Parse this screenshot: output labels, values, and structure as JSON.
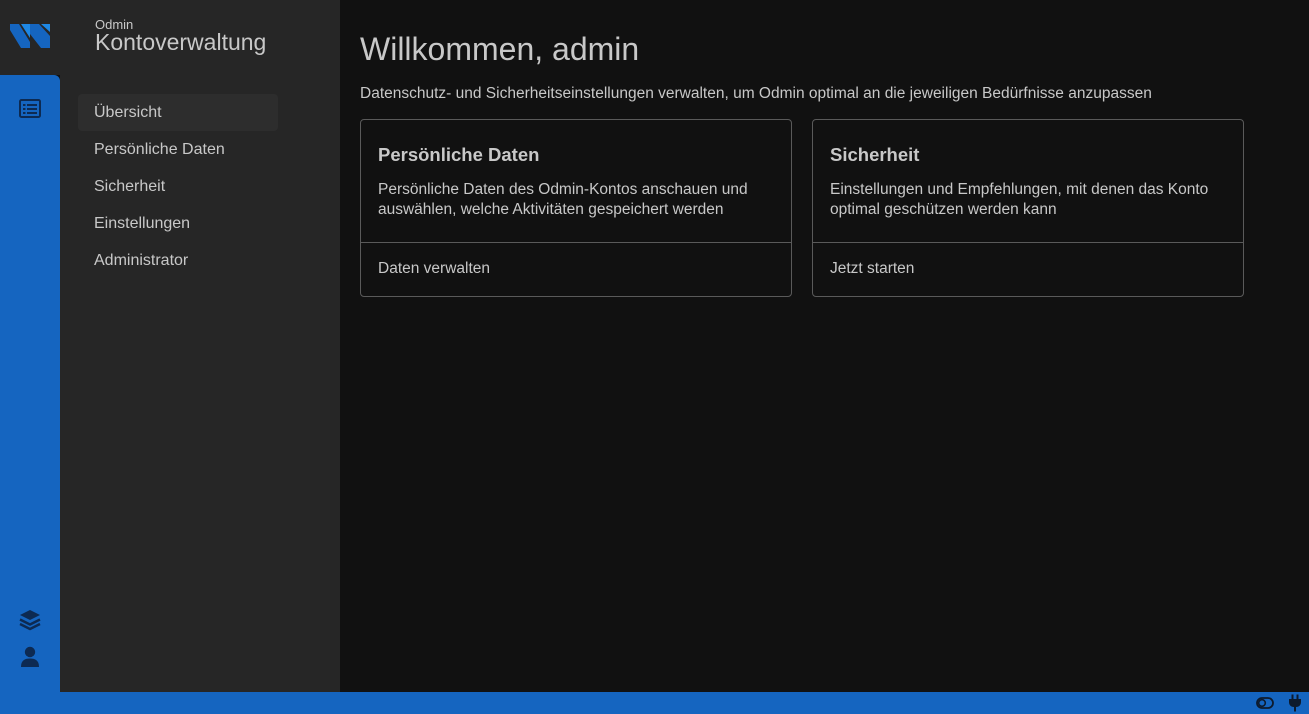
{
  "app": {
    "subtitle": "Odmin",
    "title": "Kontoverwaltung"
  },
  "rail": {
    "icons": [
      "list-icon",
      "layers-icon",
      "user-icon"
    ]
  },
  "nav": {
    "items": [
      {
        "label": "Übersicht",
        "active": true
      },
      {
        "label": "Persönliche Daten",
        "active": false
      },
      {
        "label": "Sicherheit",
        "active": false
      },
      {
        "label": "Einstellungen",
        "active": false
      },
      {
        "label": "Administrator",
        "active": false
      }
    ]
  },
  "main": {
    "title": "Willkommen, admin",
    "subtitle": "Datenschutz- und Sicherheitseinstellungen verwalten, um Odmin optimal an die jeweiligen Bedürfnisse anzupassen",
    "cards": [
      {
        "title": "Persönliche Daten",
        "description": "Persönliche Daten des Odmin-Kontos anschauen und auswählen, welche Aktivitäten gespeichert werden",
        "action": "Daten verwalten"
      },
      {
        "title": "Sicherheit",
        "description": "Einstellungen und Empfehlungen, mit denen das Konto optimal geschützen werden kann",
        "action": "Jetzt starten"
      }
    ]
  },
  "statusbar": {
    "icons": [
      "toggle-icon",
      "plug-icon"
    ]
  },
  "colors": {
    "accent": "#1565c0",
    "background": "#111111",
    "panel": "#262626",
    "text": "#c8c8c8",
    "border": "#5a5a5a"
  }
}
